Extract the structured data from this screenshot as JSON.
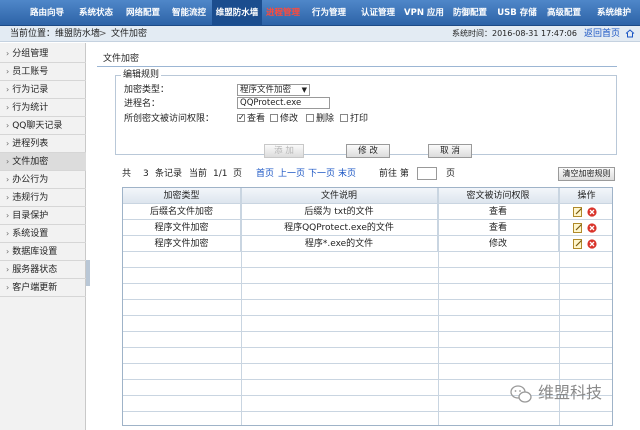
{
  "topnav": {
    "items": [
      {
        "label": "路由向导",
        "active": false
      },
      {
        "label": "系统状态",
        "active": false
      },
      {
        "label": "网络配置",
        "active": false
      },
      {
        "label": "智能流控",
        "active": false
      },
      {
        "label": "维盟防水墙",
        "active": true
      },
      {
        "label": "进程管理",
        "active": false
      },
      {
        "label": "行为管理",
        "active": false
      },
      {
        "label": "认证管理",
        "active": false
      },
      {
        "label": "VPN 应用",
        "active": false
      },
      {
        "label": "防御配置",
        "active": false
      },
      {
        "label": "USB 存储",
        "active": false
      },
      {
        "label": "高级配置",
        "active": false
      },
      {
        "label": "系统维护",
        "active": false
      }
    ]
  },
  "locbar": {
    "prefix": "当前位置：维盟防水墙",
    "separator": ">",
    "current": "文件加密",
    "time_label": "系统时间：2016-08-31 17:47:06",
    "home_link": "返回首页"
  },
  "sidebar": {
    "items": [
      {
        "label": "分组管理"
      },
      {
        "label": "员工账号"
      },
      {
        "label": "行为记录"
      },
      {
        "label": "行为统计"
      },
      {
        "label": "QQ聊天记录"
      },
      {
        "label": "进程列表"
      },
      {
        "label": "文件加密"
      },
      {
        "label": "办公行为"
      },
      {
        "label": "违规行为"
      },
      {
        "label": "目录保护"
      },
      {
        "label": "系统设置"
      },
      {
        "label": "数据库设置"
      },
      {
        "label": "服务器状态"
      },
      {
        "label": "客户端更新"
      }
    ],
    "active_index": 6
  },
  "main": {
    "tab_title": "文件加密",
    "form": {
      "legend": "编辑规则",
      "enc_type_label": "加密类型：",
      "enc_type_value": "程序文件加密",
      "process_label": "进程名：",
      "process_value": "QQProtect.exe",
      "perm_label": "所创密文被访问权限：",
      "permissions": [
        {
          "label": "查看",
          "checked": true
        },
        {
          "label": "修改",
          "checked": false
        },
        {
          "label": "删除",
          "checked": false
        },
        {
          "label": "打印",
          "checked": false
        }
      ],
      "buttons": {
        "add": "添 加",
        "modify": "修 改",
        "cancel": "取 消"
      }
    },
    "pager": {
      "total_prefix": "共",
      "total_count": "3",
      "total_suffix": "条记录",
      "current_label": "当前",
      "current_page": "1/1",
      "page_unit": "页",
      "first": "首页",
      "prev": "上一页",
      "next": "下一页",
      "last": "末页",
      "goto_label": "前往 第",
      "goto_unit": "页",
      "clear_button": "清空加密规则"
    },
    "table": {
      "headers": [
        "加密类型",
        "文件说明",
        "密文被访问权限",
        "操作"
      ],
      "rows": [
        {
          "type": "后缀名文件加密",
          "desc": "后缀为 txt的文件",
          "perm": "查看"
        },
        {
          "type": "程序文件加密",
          "desc": "程序QQProtect.exe的文件",
          "perm": "查看"
        },
        {
          "type": "程序文件加密",
          "desc": "程序*.exe的文件",
          "perm": "修改"
        }
      ]
    }
  },
  "watermark": {
    "text": "维盟科技"
  },
  "colors": {
    "nav": "#2d63a7",
    "active_nav": "#1b4d8e",
    "link": "#1a55c4",
    "delete": "#d9342b"
  }
}
